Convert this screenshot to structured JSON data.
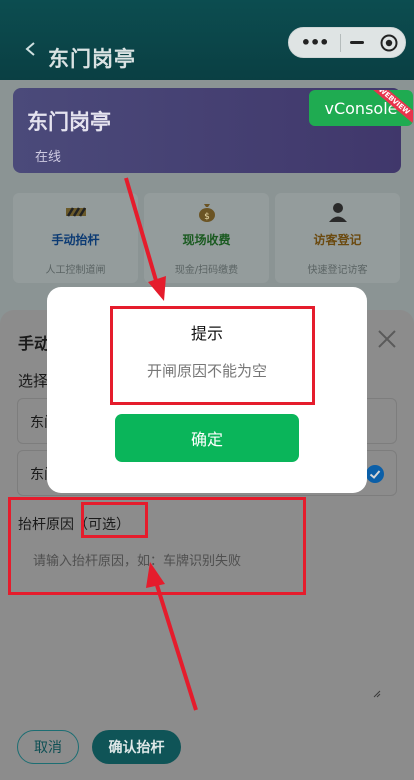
{
  "header": {
    "title": "东门岗亭",
    "capsule_menu": "•••"
  },
  "station": {
    "name": "东门岗亭",
    "status": "在线"
  },
  "vconsole": {
    "label": "vConsole",
    "ribbon": "WEBVIEW"
  },
  "quick_actions": [
    {
      "label": "手动抬杆",
      "desc": "人工控制道闸",
      "icon": "barrier-icon",
      "color": "#0b3a73"
    },
    {
      "label": "现场收费",
      "desc": "现金/扫码缴费",
      "icon": "money-bag-icon",
      "color": "#1a5a20"
    },
    {
      "label": "访客登记",
      "desc": "快速登记访客",
      "icon": "visitor-icon",
      "color": "#6b4a10"
    }
  ],
  "sheet": {
    "title": "手动",
    "select_label": "选择",
    "gates": [
      "东门",
      "东门"
    ],
    "reason_label": "抬杆原因",
    "reason_optional": "（可选）",
    "reason_placeholder": "请输入抬杆原因，如：车牌识别失败",
    "cancel_label": "取消",
    "confirm_label": "确认抬杆"
  },
  "modal": {
    "title": "提示",
    "message": "开闸原因不能为空",
    "ok_label": "确定"
  },
  "colors": {
    "annotation": "#e51c2c",
    "ok_button": "#0ab55a",
    "vconsole": "#1fab51"
  }
}
